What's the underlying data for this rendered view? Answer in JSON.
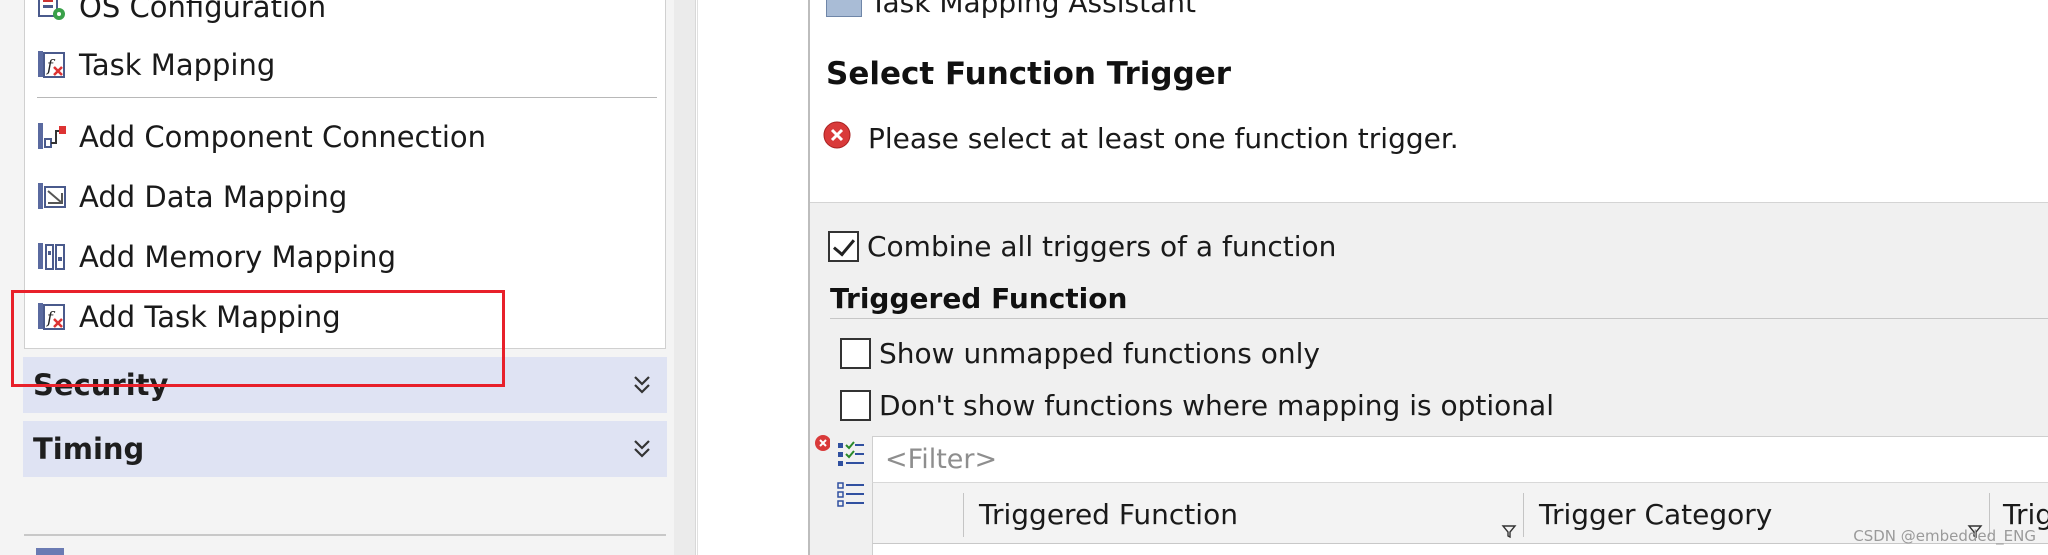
{
  "left_panel": {
    "items": [
      {
        "label": "OS Configuration",
        "icon": "os-configuration-icon"
      },
      {
        "label": "Task Mapping",
        "icon": "task-mapping-icon"
      },
      {
        "label": "Add Component Connection",
        "icon": "component-connection-icon"
      },
      {
        "label": "Add Data Mapping",
        "icon": "data-mapping-icon"
      },
      {
        "label": "Add Memory Mapping",
        "icon": "memory-mapping-icon"
      },
      {
        "label": "Add Task Mapping",
        "icon": "task-mapping-icon"
      }
    ],
    "sections": [
      {
        "label": "Security",
        "icon": "chevron-double-down-icon"
      },
      {
        "label": "Timing",
        "icon": "chevron-double-down-icon"
      }
    ],
    "highlight_color": "#e8202a"
  },
  "dialog": {
    "window_title": "Task Mapping Assistant",
    "title": "Select Function Trigger",
    "error_message": "Please select at least one function trigger.",
    "combine_triggers": {
      "label": "Combine all triggers of a function",
      "checked": true
    },
    "group_title": "Triggered Function",
    "show_unmapped": {
      "label": "Show unmapped functions only",
      "checked": false
    },
    "dont_show_optional": {
      "label": "Don't show functions where mapping is optional",
      "checked": false
    },
    "filter_placeholder": "<Filter>",
    "table_columns": [
      "Triggered Function",
      "Trigger Category",
      "Trigger"
    ]
  },
  "watermark": "CSDN @embedded_ENG",
  "colors": {
    "section_bg": "#dfe3f3",
    "error_red": "#d93a3a",
    "accent_blue": "#3050a0"
  }
}
